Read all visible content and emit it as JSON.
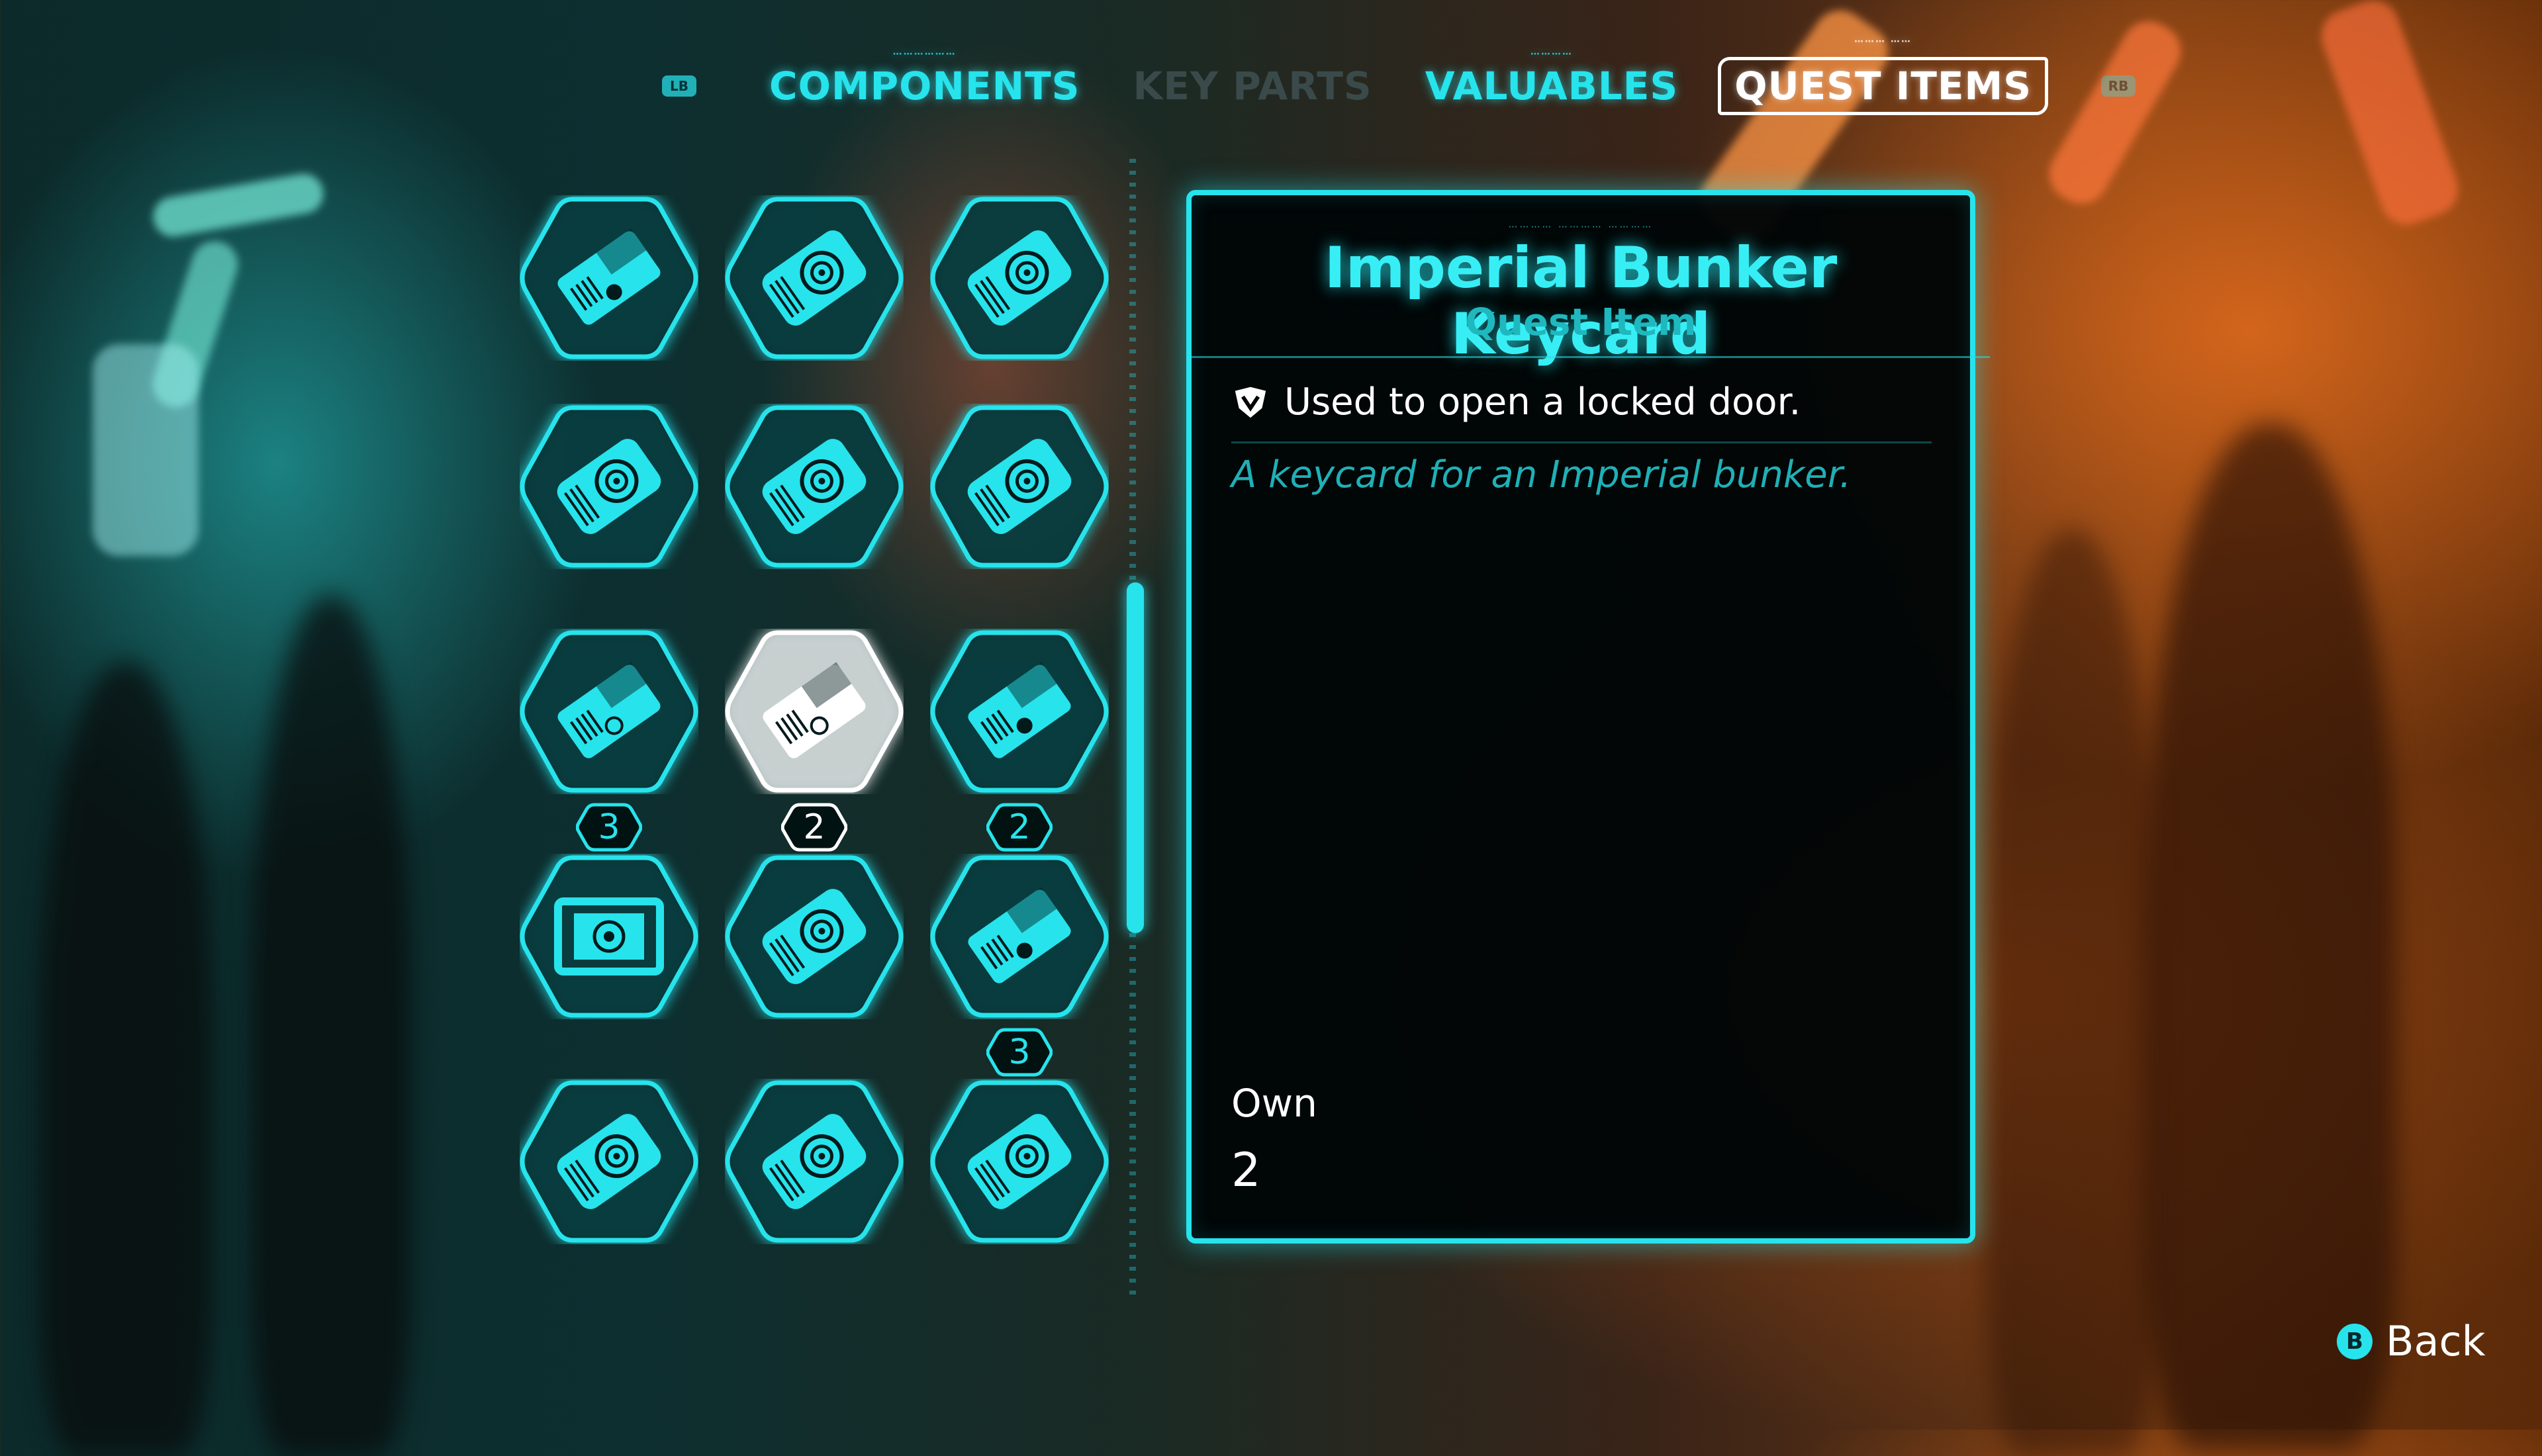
{
  "tabs": {
    "left_bumper": "LB",
    "right_bumper": "RB",
    "items": [
      {
        "label": "COMPONENTS",
        "state": "normal"
      },
      {
        "label": "KEY PARTS",
        "state": "dim"
      },
      {
        "label": "VALUABLES",
        "state": "normal"
      },
      {
        "label": "QUEST ITEMS",
        "state": "active"
      }
    ]
  },
  "grid": {
    "items": [
      {
        "icon": "keycard-icon",
        "count": ""
      },
      {
        "icon": "disc-drive-icon",
        "count": ""
      },
      {
        "icon": "disc-drive-icon",
        "count": ""
      },
      {
        "icon": "disc-drive-icon",
        "count": ""
      },
      {
        "icon": "disc-drive-icon",
        "count": ""
      },
      {
        "icon": "disc-drive-icon",
        "count": ""
      },
      {
        "icon": "imperial-keycard-icon",
        "count": "3"
      },
      {
        "icon": "imperial-keycard-icon",
        "count": "2",
        "selected": true
      },
      {
        "icon": "keycard-icon",
        "count": "2"
      },
      {
        "icon": "imperial-chip-icon",
        "count": ""
      },
      {
        "icon": "disc-drive-icon",
        "count": ""
      },
      {
        "icon": "keycard-icon",
        "count": "3"
      },
      {
        "icon": "disc-drive-icon",
        "count": ""
      },
      {
        "icon": "disc-drive-icon",
        "count": ""
      },
      {
        "icon": "disc-drive-icon",
        "count": ""
      }
    ]
  },
  "detail": {
    "title": "Imperial Bunker Keycard",
    "subtitle": "Quest Item",
    "usage": "Used to open a locked door.",
    "flavor": "A keycard for an Imperial bunker.",
    "own_label": "Own",
    "own_value": "2"
  },
  "footer": {
    "back_button": "B",
    "back_label": "Back"
  },
  "colors": {
    "accent": "#27e3ec",
    "panel_bg": "#000506",
    "text": "#ffffff"
  }
}
